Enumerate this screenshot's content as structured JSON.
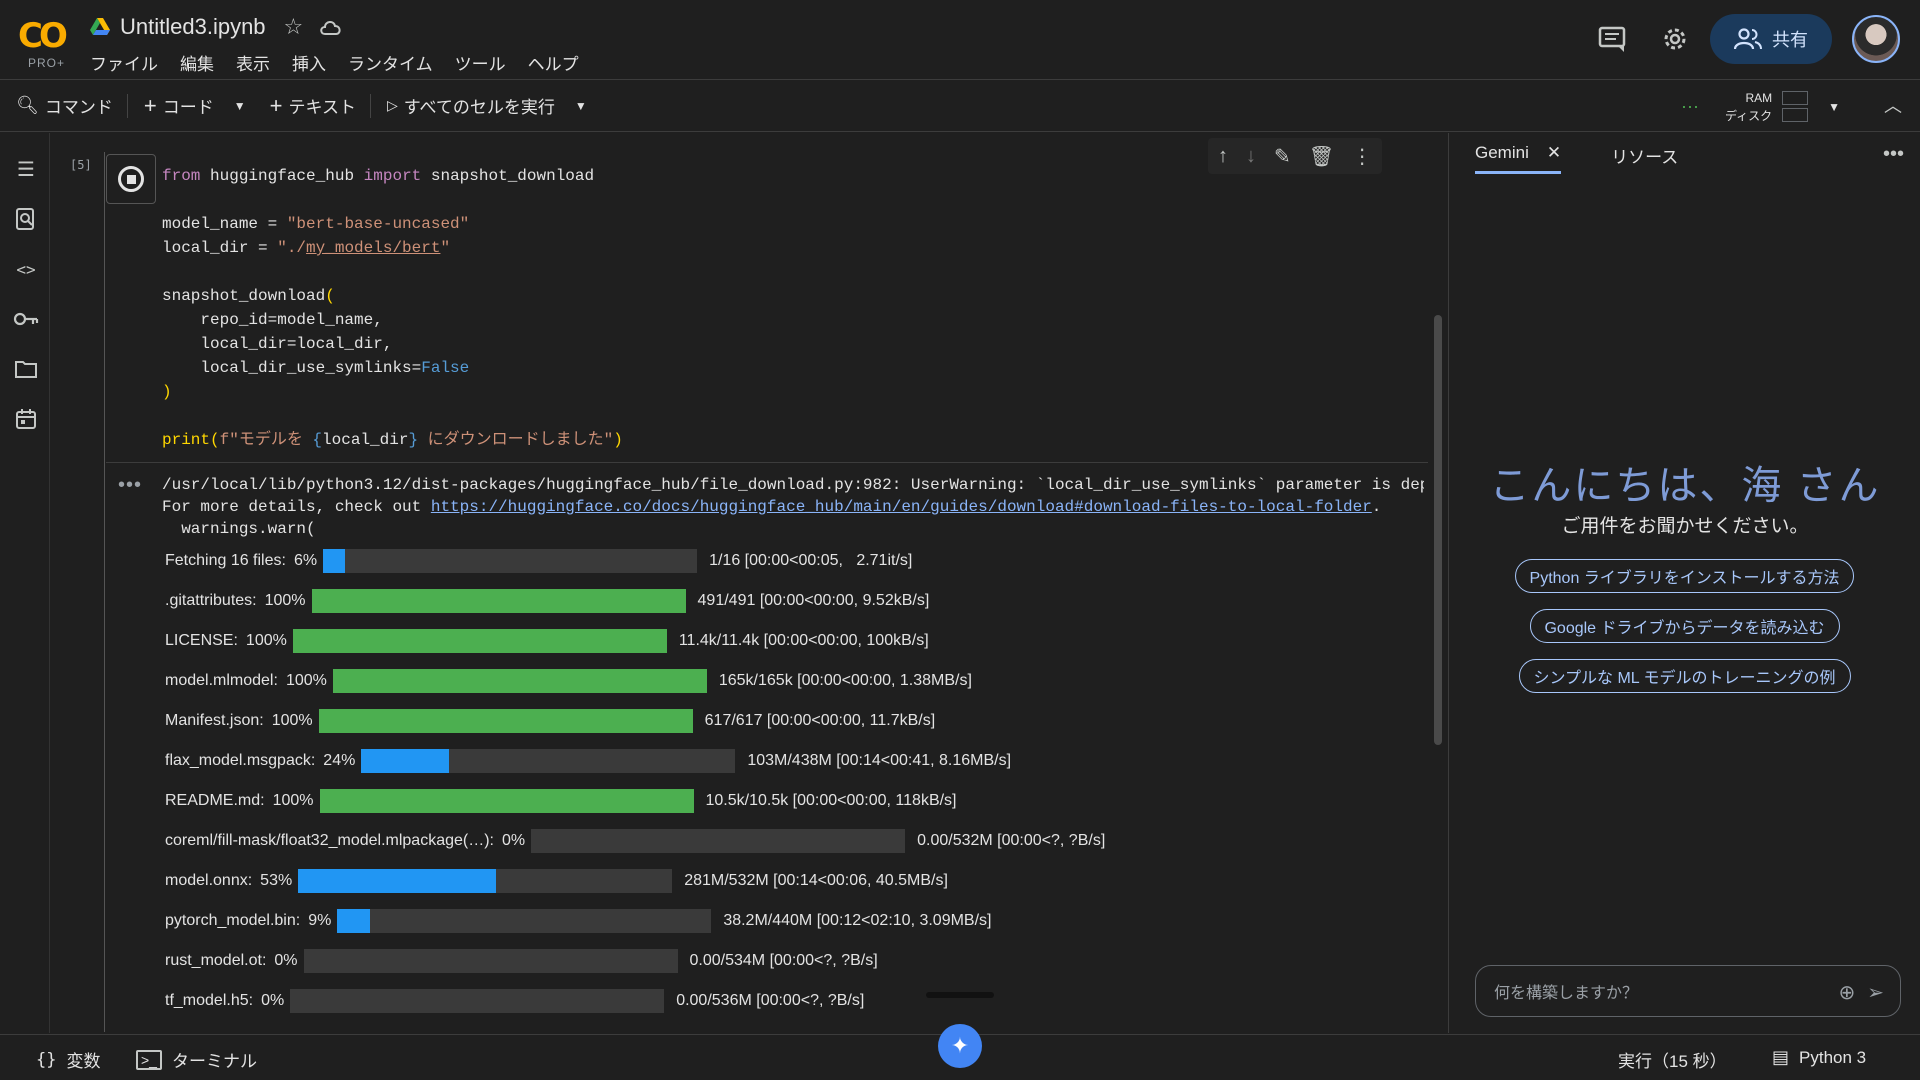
{
  "header": {
    "logo_text": "CO",
    "logo_tier": "PRO+",
    "file_name": "Untitled3.ipynb",
    "menu": [
      "ファイル",
      "編集",
      "表示",
      "挿入",
      "ランタイム",
      "ツール",
      "ヘルプ"
    ],
    "share_label": "共有"
  },
  "toolbar": {
    "command": "コマンド",
    "code": "コード",
    "text": "テキスト",
    "run_all": "すべてのセルを実行",
    "ram": "RAM",
    "disk": "ディスク"
  },
  "cell": {
    "exec_count": "[5]",
    "code_lines": [
      "from huggingface_hub import snapshot_download",
      "",
      "model_name = \"bert-base-uncased\"",
      "local_dir = \"./my_models/bert\"",
      "",
      "snapshot_download(",
      "    repo_id=model_name,",
      "    local_dir=local_dir,",
      "    local_dir_use_symlinks=False",
      ")",
      "",
      "print(f\"モデルを {local_dir} にダウンロードしました\")"
    ],
    "output": {
      "warning_line1": "/usr/local/lib/python3.12/dist-packages/huggingface_hub/file_download.py:982: UserWarning: `local_dir_use_symlinks` parameter is deprecated and will be ignored.",
      "warning_line2_prefix": "For more details, check out ",
      "warning_link": "https://huggingface.co/docs/huggingface_hub/main/en/guides/download#download-files-to-local-folder",
      "warning_line2_suffix": ".",
      "warning_line3": "  warnings.warn(",
      "progress": [
        {
          "label": "Fetching 16 files:",
          "percent_text": "6%",
          "fraction": 0.06,
          "color": "#2196f3",
          "stats": "1/16 [00:00<00:05,   2.71it/s]"
        },
        {
          "label": ".gitattributes:",
          "percent_text": "100%",
          "fraction": 1.0,
          "color": "#4caf50",
          "stats": "491/491 [00:00<00:00, 9.52kB/s]"
        },
        {
          "label": "LICENSE:",
          "percent_text": "100%",
          "fraction": 1.0,
          "color": "#4caf50",
          "stats": "11.4k/11.4k [00:00<00:00, 100kB/s]"
        },
        {
          "label": "model.mlmodel:",
          "percent_text": "100%",
          "fraction": 1.0,
          "color": "#4caf50",
          "stats": "165k/165k [00:00<00:00, 1.38MB/s]"
        },
        {
          "label": "Manifest.json:",
          "percent_text": "100%",
          "fraction": 1.0,
          "color": "#4caf50",
          "stats": "617/617 [00:00<00:00, 11.7kB/s]"
        },
        {
          "label": "flax_model.msgpack:",
          "percent_text": "24%",
          "fraction": 0.235,
          "color": "#2196f3",
          "stats": "103M/438M [00:14<00:41, 8.16MB/s]"
        },
        {
          "label": "README.md:",
          "percent_text": "100%",
          "fraction": 1.0,
          "color": "#4caf50",
          "stats": "10.5k/10.5k [00:00<00:00, 118kB/s]"
        },
        {
          "label": "coreml/fill-mask/float32_model.mlpackage(…):",
          "percent_text": "0%",
          "fraction": 0.0,
          "color": "#2196f3",
          "stats": "0.00/532M [00:00<?, ?B/s]"
        },
        {
          "label": "model.onnx:",
          "percent_text": "53%",
          "fraction": 0.53,
          "color": "#2196f3",
          "stats": "281M/532M [00:14<00:06, 40.5MB/s]"
        },
        {
          "label": "pytorch_model.bin:",
          "percent_text": "9%",
          "fraction": 0.087,
          "color": "#2196f3",
          "stats": "38.2M/440M [00:12<02:10, 3.09MB/s]"
        },
        {
          "label": "rust_model.ot:",
          "percent_text": "0%",
          "fraction": 0.0,
          "color": "#2196f3",
          "stats": "0.00/534M [00:00<?, ?B/s]"
        },
        {
          "label": "tf_model.h5:",
          "percent_text": "0%",
          "fraction": 0.0,
          "color": "#2196f3",
          "stats": "0.00/536M [00:00<?, ?B/s]"
        }
      ]
    }
  },
  "panel": {
    "tab_gemini": "Gemini",
    "tab_resources": "リソース",
    "greeting": "こんにちは、海 さん",
    "subtitle": "ご用件をお聞かせください。",
    "chips": [
      "Python ライブラリをインストールする方法",
      "Google ドライブからデータを読み込む",
      "シンプルな ML モデルのトレーニングの例"
    ],
    "prompt_placeholder": "何を構築しますか？"
  },
  "status": {
    "variables": "変数",
    "terminal": "ターミナル",
    "running": "実行（15 秒）",
    "runtime": "Python 3"
  },
  "colors": {
    "accent_blue": "#2196f3",
    "accent_green": "#4caf50",
    "background": "#1f1f1f"
  }
}
